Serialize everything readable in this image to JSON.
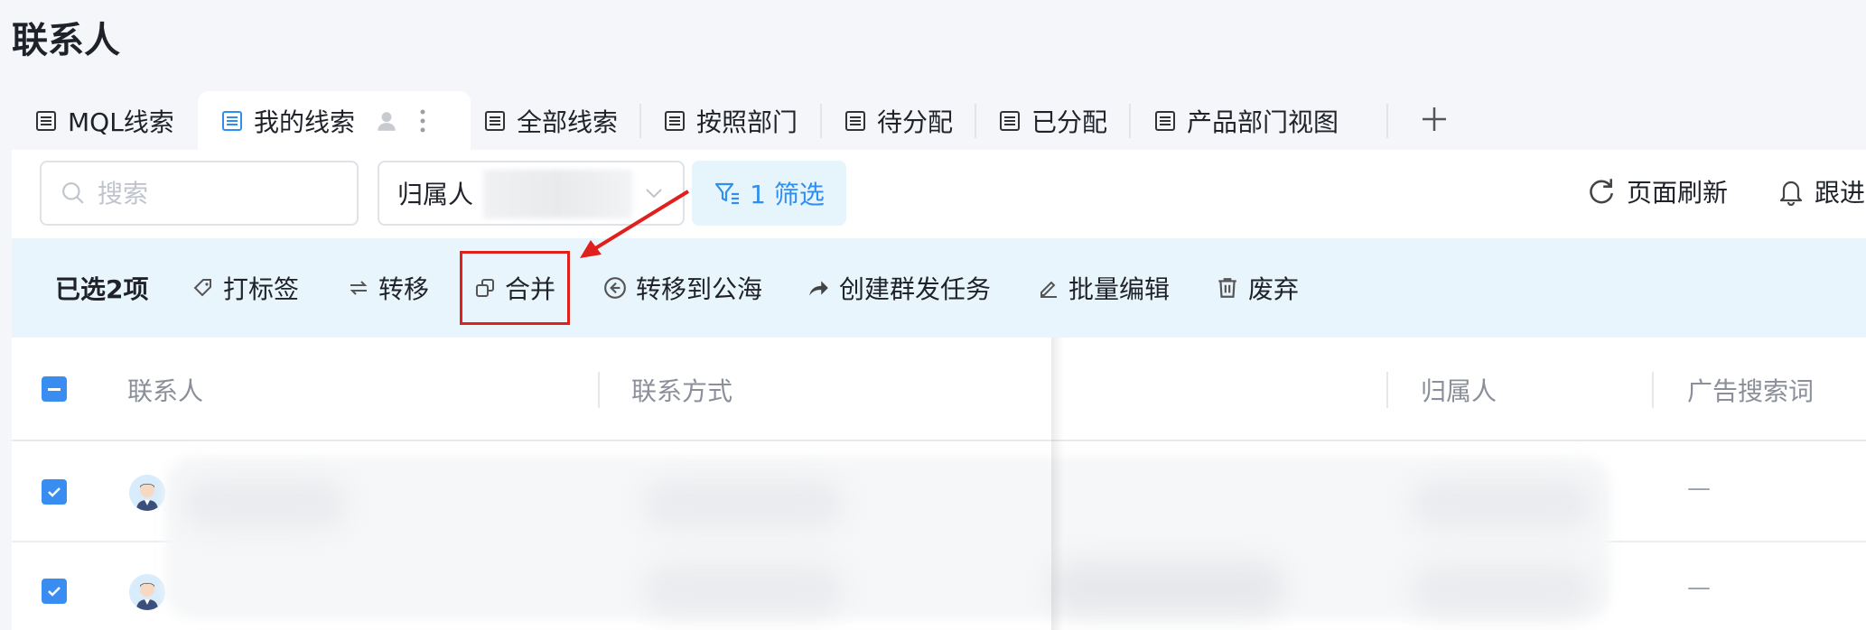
{
  "page": {
    "title": "联系人"
  },
  "tabs": [
    {
      "label": "MQL线索",
      "active": false
    },
    {
      "label": "我的线索",
      "active": true
    },
    {
      "label": "全部线索",
      "active": false
    },
    {
      "label": "按照部门",
      "active": false
    },
    {
      "label": "待分配",
      "active": false
    },
    {
      "label": "已分配",
      "active": false
    },
    {
      "label": "产品部门视图",
      "active": false
    }
  ],
  "toolbar": {
    "search_placeholder": "搜索",
    "owner_label": "归属人",
    "filter_label": "1 筛选",
    "refresh_label": "页面刷新",
    "follow_label": "跟进"
  },
  "bulk": {
    "selected_text": "已选2项",
    "actions": {
      "tag": "打标签",
      "transfer": "转移",
      "merge": "合并",
      "to_sea": "转移到公海",
      "mass_task": "创建群发任务",
      "batch_edit": "批量编辑",
      "discard": "废弃"
    }
  },
  "table": {
    "columns": [
      "联系人",
      "联系方式",
      "归属人",
      "广告搜索词"
    ],
    "rows": [
      {
        "selected": true,
        "ad_keyword": "—"
      },
      {
        "selected": true,
        "ad_keyword": "—"
      }
    ]
  },
  "colors": {
    "accent": "#2e8ff0",
    "annotation": "#e0201c",
    "bulk_bg": "#e9f5fc"
  },
  "icons": [
    "list-icon",
    "user-icon",
    "more-vertical-icon",
    "plus-icon",
    "search-icon",
    "chevron-down-icon",
    "filter-icon",
    "refresh-icon",
    "bell-icon",
    "tag-icon",
    "transfer-icon",
    "merge-icon",
    "sea-icon",
    "share-icon",
    "edit-icon",
    "trash-icon"
  ]
}
